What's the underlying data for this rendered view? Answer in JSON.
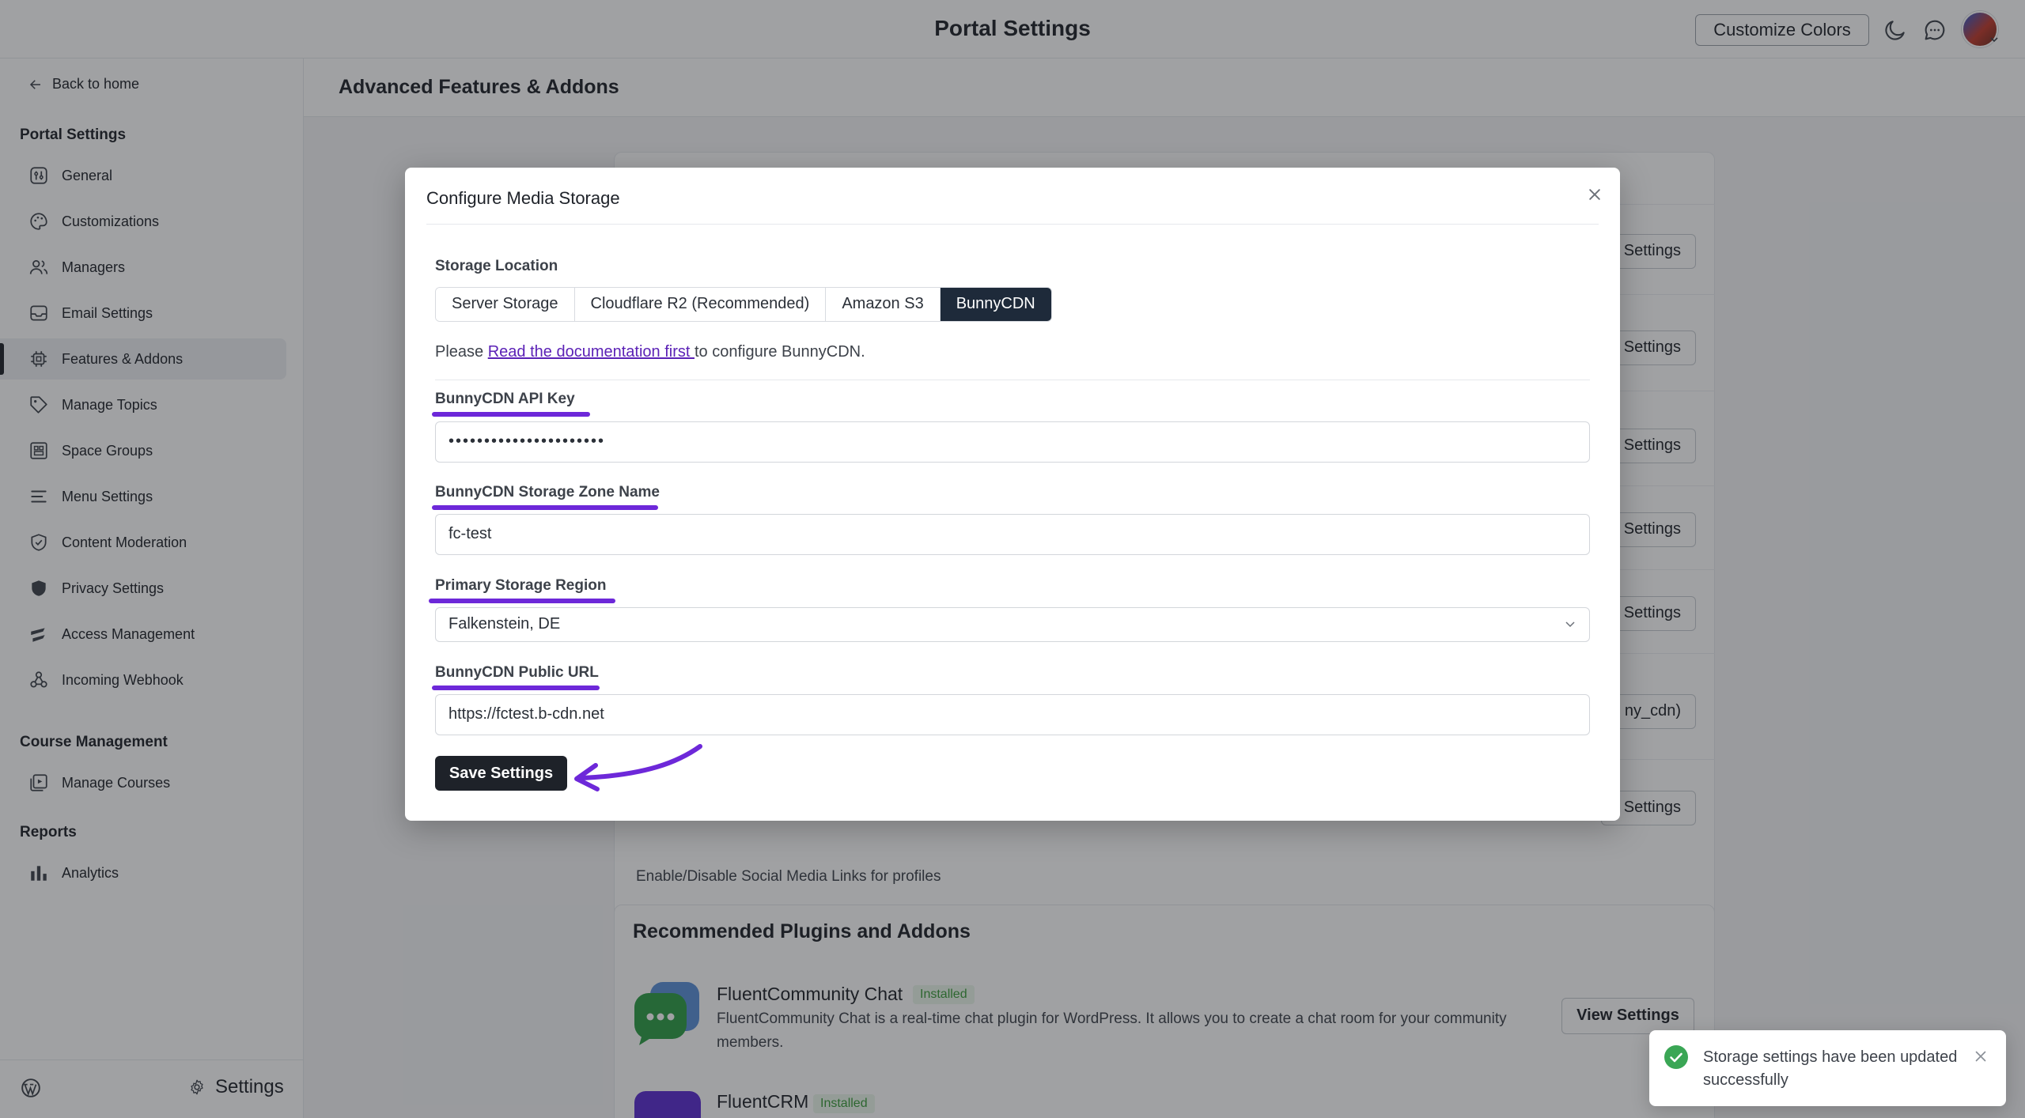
{
  "topbar": {
    "title": "Portal Settings",
    "customize_label": "Customize Colors",
    "icons": [
      "moon-icon",
      "chat-icon",
      "avatar"
    ]
  },
  "sidebar": {
    "back_label": "Back to home",
    "section_portal": "Portal Settings",
    "portal_items": [
      {
        "label": "General",
        "icon": "sliders-icon"
      },
      {
        "label": "Customizations",
        "icon": "palette-icon"
      },
      {
        "label": "Managers",
        "icon": "users-icon"
      },
      {
        "label": "Email Settings",
        "icon": "mail-icon"
      },
      {
        "label": "Features & Addons",
        "icon": "cpu-icon",
        "active": true
      },
      {
        "label": "Manage Topics",
        "icon": "tag-icon"
      },
      {
        "label": "Space Groups",
        "icon": "grid-icon"
      },
      {
        "label": "Menu Settings",
        "icon": "menu-icon"
      },
      {
        "label": "Content Moderation",
        "icon": "shield-check-icon"
      },
      {
        "label": "Privacy Settings",
        "icon": "shield-icon"
      },
      {
        "label": "Access Management",
        "icon": "access-icon"
      },
      {
        "label": "Incoming Webhook",
        "icon": "webhook-icon"
      }
    ],
    "section_course": "Course Management",
    "course_items": [
      {
        "label": "Manage Courses",
        "icon": "courses-icon"
      }
    ],
    "section_reports": "Reports",
    "report_items": [
      {
        "label": "Analytics",
        "icon": "bar-chart-icon"
      }
    ],
    "footer_settings": "Settings"
  },
  "main": {
    "header": "Advanced Features & Addons",
    "background_buttons": [
      "Settings",
      "Settings",
      "Settings",
      "Settings",
      "Settings",
      "ny_cdn)",
      "Settings"
    ],
    "partial_desc": "Enable/Disable Social Media Links for profiles",
    "recommended_title": "Recommended Plugins and Addons",
    "plugins": [
      {
        "name": "FluentCommunity Chat",
        "badge": "Installed",
        "desc": "FluentCommunity Chat is a real-time chat plugin for WordPress. It allows you to create a chat room for your community members.",
        "action": "View Settings"
      },
      {
        "name": "FluentCRM",
        "badge": "Installed"
      }
    ]
  },
  "modal": {
    "title": "Configure Media Storage",
    "storage_label": "Storage Location",
    "storage_options": [
      "Server Storage",
      "Cloudflare R2 (Recommended)",
      "Amazon S3",
      "BunnyCDN"
    ],
    "storage_selected": "BunnyCDN",
    "doc_prefix": "Please ",
    "doc_link": "Read the documentation first ",
    "doc_suffix": "to configure BunnyCDN.",
    "api_key_label": "BunnyCDN API Key",
    "api_key_value": "••••••••••••••••••••••",
    "zone_label": "BunnyCDN Storage Zone Name",
    "zone_value": "fc-test",
    "region_label": "Primary Storage Region",
    "region_value": "Falkenstein, DE",
    "public_url_label": "BunnyCDN Public URL",
    "public_url_value": "https://fctest.b-cdn.net",
    "save_label": "Save Settings",
    "accent_color": "#6d28d9"
  },
  "toast": {
    "message": "Storage settings have been updated successfully",
    "status_color": "#3aa655"
  }
}
